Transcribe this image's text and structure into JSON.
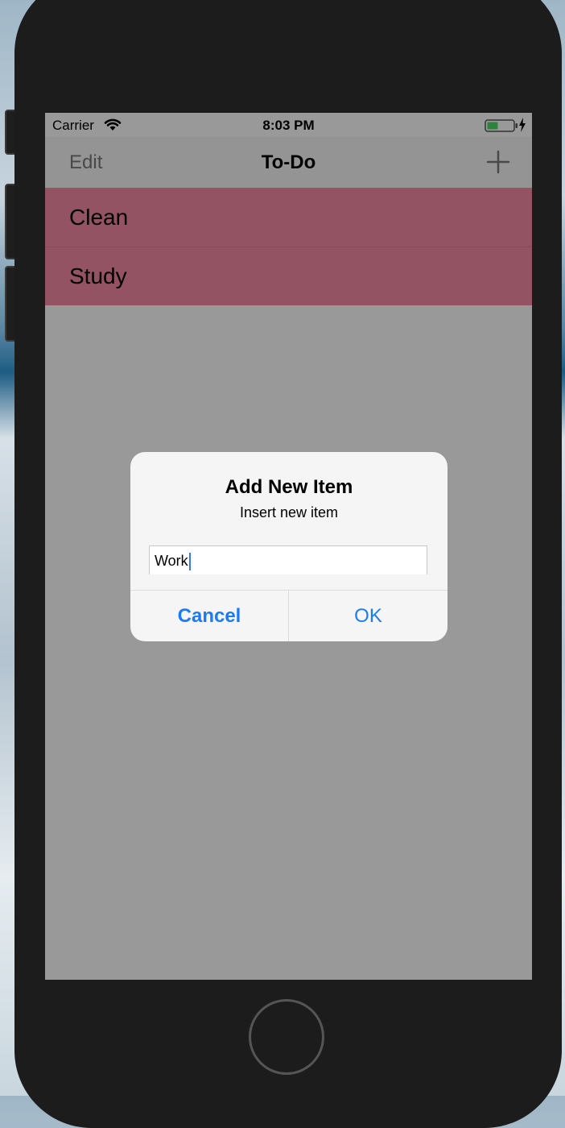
{
  "status_bar": {
    "carrier": "Carrier",
    "time": "8:03 PM"
  },
  "nav_bar": {
    "edit_label": "Edit",
    "title": "To-Do",
    "add_icon": "plus-icon"
  },
  "list": {
    "items": [
      {
        "label": "Clean"
      },
      {
        "label": "Study"
      }
    ],
    "row_color": "#f58aa3"
  },
  "alert": {
    "title": "Add New Item",
    "message": "Insert new item",
    "input_value": "Work",
    "cancel_label": "Cancel",
    "ok_label": "OK",
    "accent_color": "#1a7cf4"
  },
  "icons": {
    "wifi": "wifi-icon",
    "battery": "battery-icon",
    "charging": "charging-bolt-icon",
    "home": "home-button"
  }
}
